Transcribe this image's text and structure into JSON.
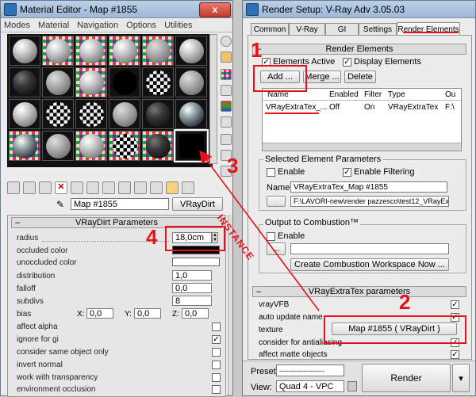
{
  "material_editor": {
    "title": "Material Editor - Map #1855",
    "menu": [
      "Modes",
      "Material",
      "Navigation",
      "Options",
      "Utilities"
    ],
    "map_name": "Map #1855",
    "map_type": "VRayDirt",
    "rollout_title": "VRayDirt Parameters",
    "params": {
      "radius_label": "radius",
      "radius_value": "18,0cm",
      "occluded_color": "occluded color",
      "unoccluded_color": "unoccluded color",
      "distribution_label": "distribution",
      "distribution_value": "1,0",
      "falloff_label": "falloff",
      "falloff_value": "0,0",
      "subdivs_label": "subdivs",
      "subdivs_value": "8",
      "bias_label": "bias",
      "bias_x_label": "X:",
      "bias_x": "0,0",
      "bias_y_label": "Y:",
      "bias_y": "0,0",
      "bias_z_label": "Z:",
      "bias_z": "0,0",
      "affect_alpha": "affect alpha",
      "ignore_for_gi": "ignore for gi",
      "consider_same_object_only": "consider same object only",
      "invert_normal": "invert normal",
      "work_with_transparency": "work with transparency",
      "environment_occlusion": "environment occlusion"
    }
  },
  "render_setup": {
    "title": "Render Setup: V-Ray Adv 3.05.03",
    "tabs": [
      "Common",
      "V-Ray",
      "GI",
      "Settings",
      "Render Elements"
    ],
    "render_elements_title": "Render Elements",
    "elements_active": "Elements Active",
    "display_elements": "Display Elements",
    "buttons": {
      "add": "Add ...",
      "merge": "Merge ...",
      "delete": "Delete"
    },
    "table": {
      "headers": [
        "Name",
        "Enabled",
        "Filter",
        "Type",
        "Ou"
      ],
      "rows": [
        [
          "VRayExtraTex_...",
          "Off",
          "On",
          "VRayExtraTex",
          "F:\\"
        ]
      ]
    },
    "selected_params_title": "Selected Element Parameters",
    "enable": "Enable",
    "enable_filtering": "Enable Filtering",
    "name_label": "Name:",
    "name_value": "VRayExtraTex_Map #1855",
    "path_value": "F:\\LAVORI-new\\render pazzesco\\test12_VRayExt",
    "output_combustion": "Output to Combustion™",
    "combustion_enable": "Enable",
    "combustion_btn": "...",
    "create_combustion": "Create Combustion Workspace Now ...",
    "extra_tex_title": "VRayExtraTex parameters",
    "vrayvfb": "vrayVFB",
    "auto_update_name": "auto update name",
    "texture_label": "texture",
    "texture_btn": "Map #1855  ( VRayDirt )",
    "consider_for_antialiasing": "consider for antialiasing",
    "affect_matte_objects": "affect matte objects",
    "preset_label": "Preset:",
    "preset_value": "-------------------",
    "view_label": "View:",
    "view_value": "Quad 4 - VPC",
    "render_btn": "Render"
  },
  "annotations": {
    "one": "1",
    "two": "2",
    "three": "3",
    "four": "4",
    "instance": "INSTANCE",
    "color": "#e8101a"
  },
  "close_glyph": "x"
}
